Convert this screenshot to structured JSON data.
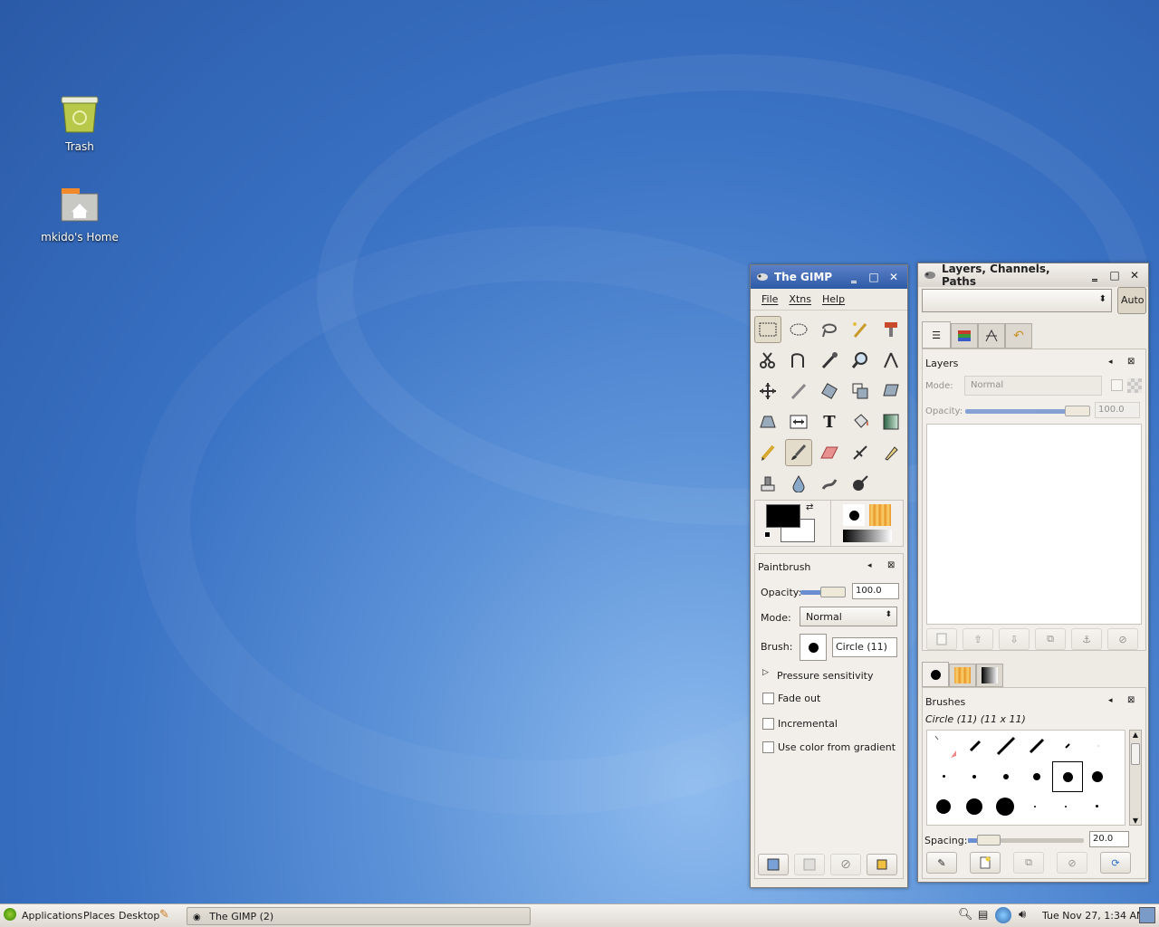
{
  "desktop": {
    "icons": [
      {
        "label": "Trash",
        "icon": "trash-icon"
      },
      {
        "label": "mkido's Home",
        "icon": "home-folder-icon"
      }
    ]
  },
  "toolbox": {
    "title": "The GIMP",
    "menus": [
      "File",
      "Xtns",
      "Help"
    ],
    "tool_options": {
      "title": "Paintbrush",
      "opacity_label": "Opacity:",
      "opacity_value": "100.0",
      "mode_label": "Mode:",
      "mode_value": "Normal",
      "brush_label": "Brush:",
      "brush_value": "Circle (11)",
      "pressure_label": "Pressure sensitivity",
      "fade_label": "Fade out",
      "incremental_label": "Incremental",
      "gradient_label": "Use color from gradient"
    }
  },
  "dock": {
    "title": "Layers, Channels, Paths",
    "auto_label": "Auto",
    "layers": {
      "title": "Layers",
      "mode_label": "Mode:",
      "mode_value": "Normal",
      "opacity_label": "Opacity:",
      "opacity_value": "100.0"
    },
    "brushes": {
      "title": "Brushes",
      "selected": "Circle (11) (11 x 11)",
      "spacing_label": "Spacing:",
      "spacing_value": "20.0"
    }
  },
  "taskbar": {
    "menus": [
      "Applications",
      "Places",
      "Desktop"
    ],
    "window_button": "The GIMP (2)",
    "clock": "Tue Nov 27,  1:34 AM"
  },
  "colors": {
    "titlebar_active": "#2e5aa6",
    "desktop": "#3a72c4"
  }
}
